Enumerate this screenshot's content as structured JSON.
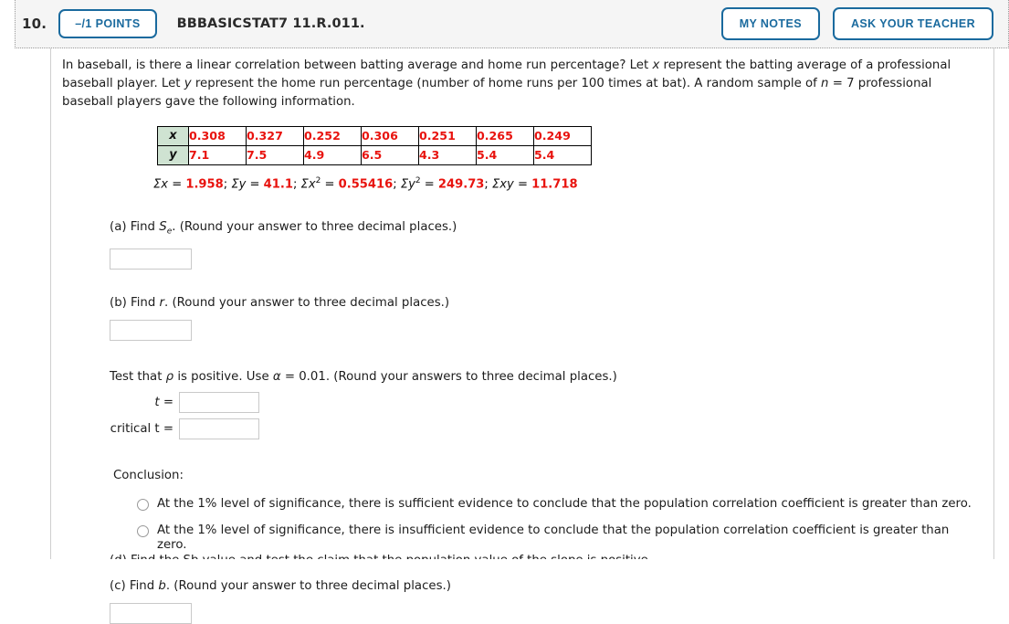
{
  "header": {
    "question_number": "10.",
    "points_label": "–/1 POINTS",
    "question_code": "BBBASICSTAT7 11.R.011.",
    "my_notes_label": "MY NOTES",
    "ask_teacher_label": "ASK YOUR TEACHER",
    "accent_color": "#1a6a9e",
    "background_color": "#f5f5f5"
  },
  "problem": {
    "line1_a": "In baseball, is there a linear correlation between batting average and home run percentage? Let ",
    "var_x": "x",
    "line1_b": " represent the batting average of a professional",
    "line2_a": "baseball player. Let ",
    "var_y": "y",
    "line2_b": " represent the home run percentage (number of home runs per 100 times at bat). A random sample of ",
    "var_n": "n",
    "line2_c": " = 7 professional baseball",
    "line3": "players gave the following information."
  },
  "table": {
    "row_x_label": "x",
    "row_y_label": "y",
    "x_values": [
      "0.308",
      "0.327",
      "0.252",
      "0.306",
      "0.251",
      "0.265",
      "0.249"
    ],
    "y_values": [
      "7.1",
      "7.5",
      "4.9",
      "6.5",
      "4.3",
      "5.4",
      "5.4"
    ],
    "header_bg": "#cfe3d2",
    "value_color": "#e8130e"
  },
  "sums": {
    "sum_x_label": "Σx",
    "sum_x_value": "1.958",
    "sum_y_label": "Σy",
    "sum_y_value": "41.1",
    "sum_x2_label": "Σx",
    "sum_x2_exp": "2",
    "sum_x2_value": "0.55416",
    "sum_y2_label": "Σy",
    "sum_y2_exp": "2",
    "sum_y2_value": "249.73",
    "sum_xy_label": "Σxy",
    "sum_xy_value": "11.718",
    "sep": "; ",
    "eq": " = "
  },
  "parts": {
    "a": {
      "prefix": "(a) Find ",
      "symbol": "S",
      "subscript": "e",
      "suffix": ". (Round your answer to three decimal places.)",
      "answer_value": "",
      "placeholder": ""
    },
    "b": {
      "prefix": "(b) Find ",
      "symbol": "r",
      "suffix": ". (Round your answer to three decimal places.)",
      "answer_value": "",
      "placeholder": ""
    },
    "c": {
      "prefix": "(c) Find ",
      "symbol": "b",
      "suffix": ". (Round your answer to three decimal places.)",
      "answer_value": "",
      "placeholder": ""
    }
  },
  "test": {
    "prompt_a": "Test that ",
    "rho": "ρ",
    "prompt_b": " is positive. Use ",
    "alpha": "α",
    "prompt_c": " = 0.01. (Round your answers to three decimal places.)",
    "t_label": "t =",
    "t_value": "",
    "critical_t_label": "critical t =",
    "critical_t_value": ""
  },
  "conclusion": {
    "title": "Conclusion:",
    "options": [
      "At the 1% level of significance, there is sufficient evidence to conclude that the population correlation coefficient is greater than zero.",
      "At the 1% level of significance, there is insufficient evidence to conclude that the population correlation coefficient is greater than zero."
    ],
    "selected_index": -1
  },
  "bottom_partial": {
    "text": "(d) Find the Sb value and test the claim that the population value of the slope is positive."
  }
}
